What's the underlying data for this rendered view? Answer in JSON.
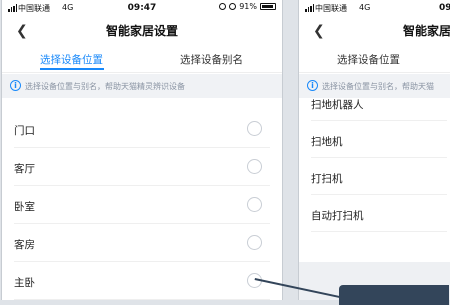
{
  "left": {
    "status": {
      "carrier": "中国联通",
      "network": "4G",
      "time": "09:47",
      "battery": "91%"
    },
    "nav": {
      "back_icon": "chevron-left-icon",
      "title": "智能家居设置"
    },
    "tabs": [
      {
        "label": "选择设备位置",
        "active": true
      },
      {
        "label": "选择设备别名",
        "active": false
      }
    ],
    "info": {
      "icon": "info-icon",
      "text": "选择设备位置与别名，帮助天猫精灵辨识设备"
    },
    "items": [
      {
        "label": "门口"
      },
      {
        "label": "客厅"
      },
      {
        "label": "卧室"
      },
      {
        "label": "客房"
      },
      {
        "label": "主卧"
      }
    ]
  },
  "right": {
    "status": {
      "carrier": "中国联通",
      "network": "4G",
      "time": "09:47"
    },
    "nav": {
      "back_icon": "chevron-left-icon",
      "title": "智能家居"
    },
    "tabs": [
      {
        "label": "选择设备位置"
      }
    ],
    "info": {
      "text": "选择设备位置与别名，帮助天猫"
    },
    "items": [
      {
        "label": "扫地机器人"
      },
      {
        "label": "扫地机"
      },
      {
        "label": "打扫机"
      },
      {
        "label": "自动打扫机"
      }
    ]
  },
  "colors": {
    "accent": "#1989fa",
    "callout": "#33455a"
  }
}
